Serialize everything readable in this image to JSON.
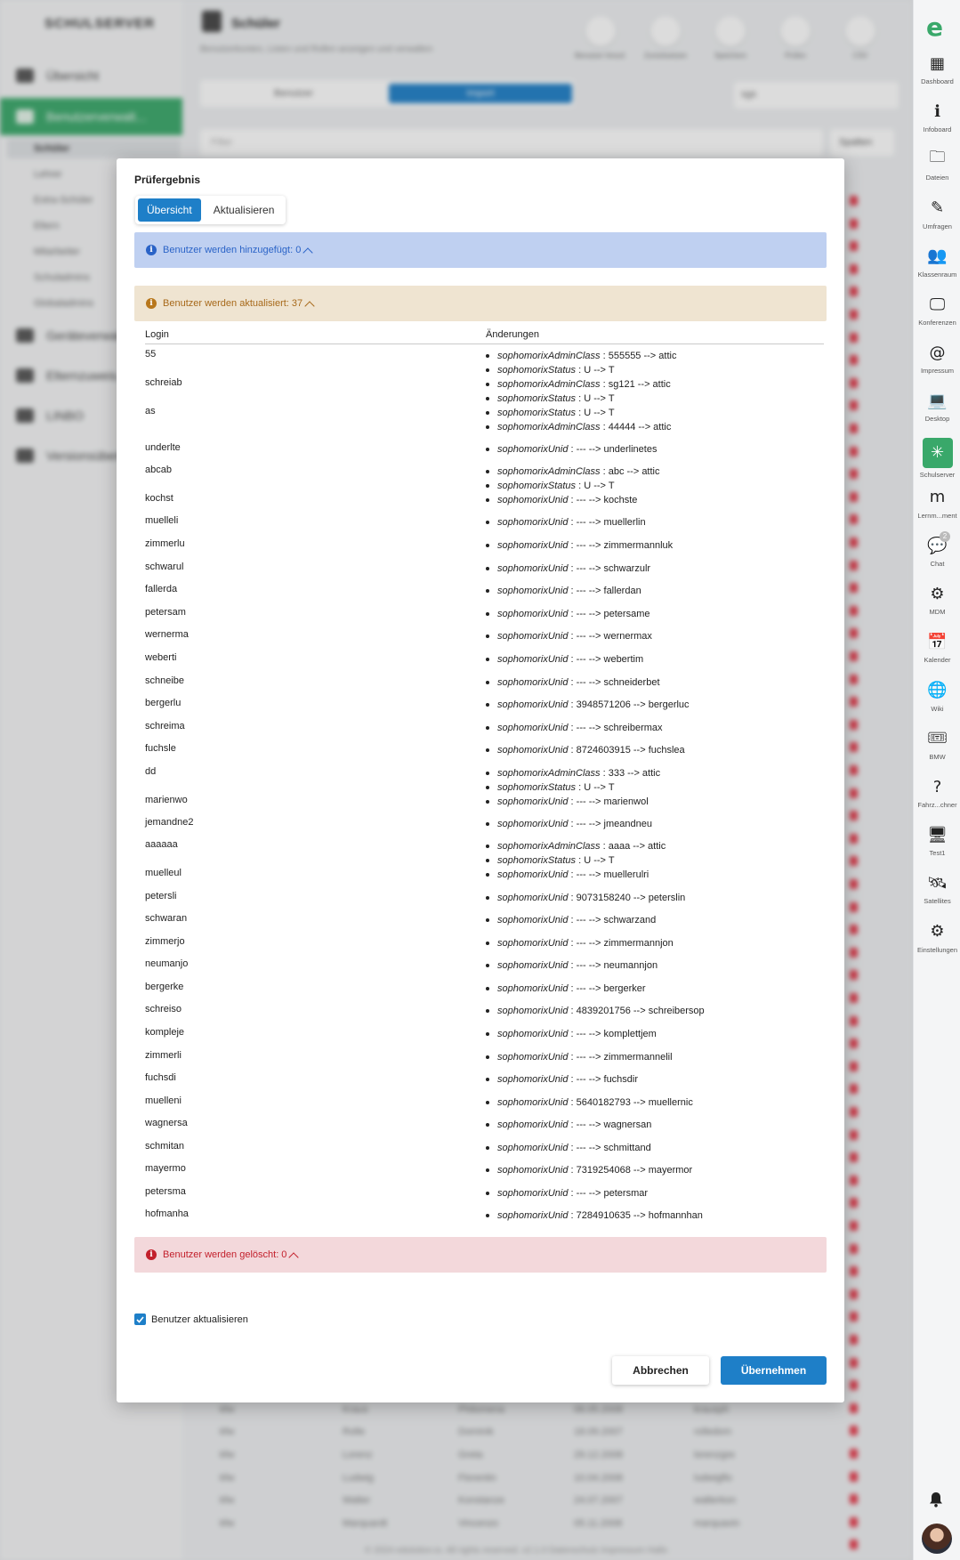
{
  "app": {
    "brand": "SCHULSERVER",
    "page_title": "Schüler",
    "page_subtitle": "Benutzerkonten, Listen und Rollen anzeigen und verwalten",
    "left_nav": [
      {
        "label": "Übersicht"
      },
      {
        "label": "Benutzerverwalt..."
      },
      {
        "label": "Geräteverwal..."
      },
      {
        "label": "Elternzuweis..."
      },
      {
        "label": "LINBO"
      },
      {
        "label": "Versionsüberb..."
      }
    ],
    "sub_nav": [
      "Schüler",
      "Lehrer",
      "Extra-Schüler",
      "Eltern",
      "Mitarbeiter",
      "Schuladmins",
      "Globaladmins"
    ],
    "toolbar": [
      "Benutzer hinzuf.",
      "Zurücksetzen",
      "Speichern",
      "Prüfen",
      "CSV"
    ],
    "tabs": {
      "t1": "Benutzer",
      "t2": "Import"
    },
    "select_value": "sgs",
    "filter_placeholder": "Filter",
    "columns_button": "Spalten",
    "bg_rows": [
      [
        "kfw",
        "Kraus",
        "Philomena",
        "06.05.2008",
        "krausph"
      ],
      [
        "kfw",
        "Rolle",
        "Dominik",
        "18.09.2007",
        "rolledom"
      ],
      [
        "kfw",
        "Lorenz",
        "Greta",
        "29.12.2008",
        "lorenzgre"
      ],
      [
        "kfw",
        "Ludwig",
        "Florentin",
        "10.04.2008",
        "ludwigflo"
      ],
      [
        "kfw",
        "Walter",
        "Konstanze",
        "24.07.2007",
        "walterkon"
      ],
      [
        "kfw",
        "Marquardt",
        "Vincenzo",
        "05.11.2008",
        "marquavin"
      ]
    ],
    "footer": "© 2024 edulution.io. All rights reserved. v2.1.0   Datenschutz   Impressum   Hallo"
  },
  "dock": [
    {
      "label": "Dashboard",
      "icon": "dashboard-icon"
    },
    {
      "label": "Infoboard",
      "icon": "infoboard-icon"
    },
    {
      "label": "Dateien",
      "icon": "folder-icon"
    },
    {
      "label": "Umfragen",
      "icon": "survey-icon"
    },
    {
      "label": "Klassenraum",
      "icon": "classroom-icon"
    },
    {
      "label": "Konferenzen",
      "icon": "conference-icon"
    },
    {
      "label": "Impressum",
      "icon": "at-icon"
    },
    {
      "label": "Desktop",
      "icon": "laptop-icon"
    },
    {
      "label": "Schulserver",
      "icon": "network-icon"
    },
    {
      "label": "Lernm...ment",
      "icon": "moodle-icon"
    },
    {
      "label": "Chat",
      "icon": "chat-icon"
    },
    {
      "label": "MDM",
      "icon": "mdm-icon"
    },
    {
      "label": "Kalender",
      "icon": "calendar-icon"
    },
    {
      "label": "Wiki",
      "icon": "wiki-icon"
    },
    {
      "label": "BMW",
      "icon": "ticket-icon"
    },
    {
      "label": "Fahrz...chner",
      "icon": "help-icon"
    },
    {
      "label": "Test1",
      "icon": "monitor-icon"
    },
    {
      "label": "Satellites",
      "icon": "satellite-icon"
    },
    {
      "label": "Einstellungen",
      "icon": "gear-icon"
    }
  ],
  "dock_chat_badge": "2",
  "dialog": {
    "title": "Prüfergebnis",
    "tabs": [
      "Übersicht",
      "Aktualisieren"
    ],
    "alert_added": "Benutzer werden hinzugefügt: 0",
    "alert_updated": "Benutzer werden aktualisiert: 37",
    "alert_deleted": "Benutzer werden gelöscht: 0",
    "col_login": "Login",
    "col_changes": "Änderungen",
    "rows": [
      {
        "login": "55",
        "changes": [
          [
            "sophomorixAdminClass",
            "555555 --> attic"
          ],
          [
            "sophomorixStatus",
            "U --> T"
          ]
        ]
      },
      {
        "login": "schreiab",
        "changes": [
          [
            "sophomorixAdminClass",
            "sg121 --> attic"
          ],
          [
            "sophomorixStatus",
            "U --> T"
          ]
        ]
      },
      {
        "login": "as",
        "changes": [
          [
            "sophomorixStatus",
            "U --> T"
          ],
          [
            "sophomorixAdminClass",
            "44444 --> attic"
          ]
        ]
      },
      {
        "login": "underlte",
        "changes": [
          [
            "sophomorixUnid",
            "--- --> underlinetes"
          ]
        ]
      },
      {
        "login": "abcab",
        "changes": [
          [
            "sophomorixAdminClass",
            "abc --> attic"
          ],
          [
            "sophomorixStatus",
            "U --> T"
          ]
        ]
      },
      {
        "login": "kochst",
        "changes": [
          [
            "sophomorixUnid",
            "--- --> kochste"
          ]
        ]
      },
      {
        "login": "muelleli",
        "changes": [
          [
            "sophomorixUnid",
            "--- --> muellerlin"
          ]
        ]
      },
      {
        "login": "zimmerlu",
        "changes": [
          [
            "sophomorixUnid",
            "--- --> zimmermannluk"
          ]
        ]
      },
      {
        "login": "schwarul",
        "changes": [
          [
            "sophomorixUnid",
            "--- --> schwarzulr"
          ]
        ]
      },
      {
        "login": "fallerda",
        "changes": [
          [
            "sophomorixUnid",
            "--- --> fallerdan"
          ]
        ]
      },
      {
        "login": "petersam",
        "changes": [
          [
            "sophomorixUnid",
            "--- --> petersame"
          ]
        ]
      },
      {
        "login": "wernerma",
        "changes": [
          [
            "sophomorixUnid",
            "--- --> wernermax"
          ]
        ]
      },
      {
        "login": "weberti",
        "changes": [
          [
            "sophomorixUnid",
            "--- --> webertim"
          ]
        ]
      },
      {
        "login": "schneibe",
        "changes": [
          [
            "sophomorixUnid",
            "--- --> schneiderbet"
          ]
        ]
      },
      {
        "login": "bergerlu",
        "changes": [
          [
            "sophomorixUnid",
            "3948571206 --> bergerluc"
          ]
        ]
      },
      {
        "login": "schreima",
        "changes": [
          [
            "sophomorixUnid",
            "--- --> schreibermax"
          ]
        ]
      },
      {
        "login": "fuchsle",
        "changes": [
          [
            "sophomorixUnid",
            "8724603915 --> fuchslea"
          ]
        ]
      },
      {
        "login": "dd",
        "changes": [
          [
            "sophomorixAdminClass",
            "333 --> attic"
          ],
          [
            "sophomorixStatus",
            "U --> T"
          ]
        ]
      },
      {
        "login": "marienwo",
        "changes": [
          [
            "sophomorixUnid",
            "--- --> marienwol"
          ]
        ]
      },
      {
        "login": "jemandne2",
        "changes": [
          [
            "sophomorixUnid",
            "--- --> jmeandneu"
          ]
        ]
      },
      {
        "login": "aaaaaa",
        "changes": [
          [
            "sophomorixAdminClass",
            "aaaa --> attic"
          ],
          [
            "sophomorixStatus",
            "U --> T"
          ]
        ]
      },
      {
        "login": "muelleul",
        "changes": [
          [
            "sophomorixUnid",
            "--- --> muellerulri"
          ]
        ]
      },
      {
        "login": "petersli",
        "changes": [
          [
            "sophomorixUnid",
            "9073158240 --> peterslin"
          ]
        ]
      },
      {
        "login": "schwaran",
        "changes": [
          [
            "sophomorixUnid",
            "--- --> schwarzand"
          ]
        ]
      },
      {
        "login": "zimmerjo",
        "changes": [
          [
            "sophomorixUnid",
            "--- --> zimmermannjon"
          ]
        ]
      },
      {
        "login": "neumanjo",
        "changes": [
          [
            "sophomorixUnid",
            "--- --> neumannjon"
          ]
        ]
      },
      {
        "login": "bergerke",
        "changes": [
          [
            "sophomorixUnid",
            "--- --> bergerker"
          ]
        ]
      },
      {
        "login": "schreiso",
        "changes": [
          [
            "sophomorixUnid",
            "4839201756 --> schreibersop"
          ]
        ]
      },
      {
        "login": "kompleje",
        "changes": [
          [
            "sophomorixUnid",
            "--- --> komplettjem"
          ]
        ]
      },
      {
        "login": "zimmerli",
        "changes": [
          [
            "sophomorixUnid",
            "--- --> zimmermannelil"
          ]
        ]
      },
      {
        "login": "fuchsdi",
        "changes": [
          [
            "sophomorixUnid",
            "--- --> fuchsdir"
          ]
        ]
      },
      {
        "login": "muelleni",
        "changes": [
          [
            "sophomorixUnid",
            "5640182793 --> muellernic"
          ]
        ]
      },
      {
        "login": "wagnersa",
        "changes": [
          [
            "sophomorixUnid",
            "--- --> wagnersan"
          ]
        ]
      },
      {
        "login": "schmitan",
        "changes": [
          [
            "sophomorixUnid",
            "--- --> schmittand"
          ]
        ]
      },
      {
        "login": "mayermo",
        "changes": [
          [
            "sophomorixUnid",
            "7319254068 --> mayermor"
          ]
        ]
      },
      {
        "login": "petersma",
        "changes": [
          [
            "sophomorixUnid",
            "--- --> petersmar"
          ]
        ]
      },
      {
        "login": "hofmanha",
        "changes": [
          [
            "sophomorixUnid",
            "7284910635 --> hofmannhan"
          ]
        ]
      }
    ],
    "checkbox_label": "Benutzer aktualisieren",
    "checkbox_checked": true,
    "cancel_label": "Abbrechen",
    "apply_label": "Übernehmen"
  },
  "colors": {
    "accent": "#1e7fc8",
    "brand_green": "#39a86a",
    "info_blue": "#bfd0f1",
    "warn": "#efe4d1",
    "danger": "#f3d8db"
  }
}
